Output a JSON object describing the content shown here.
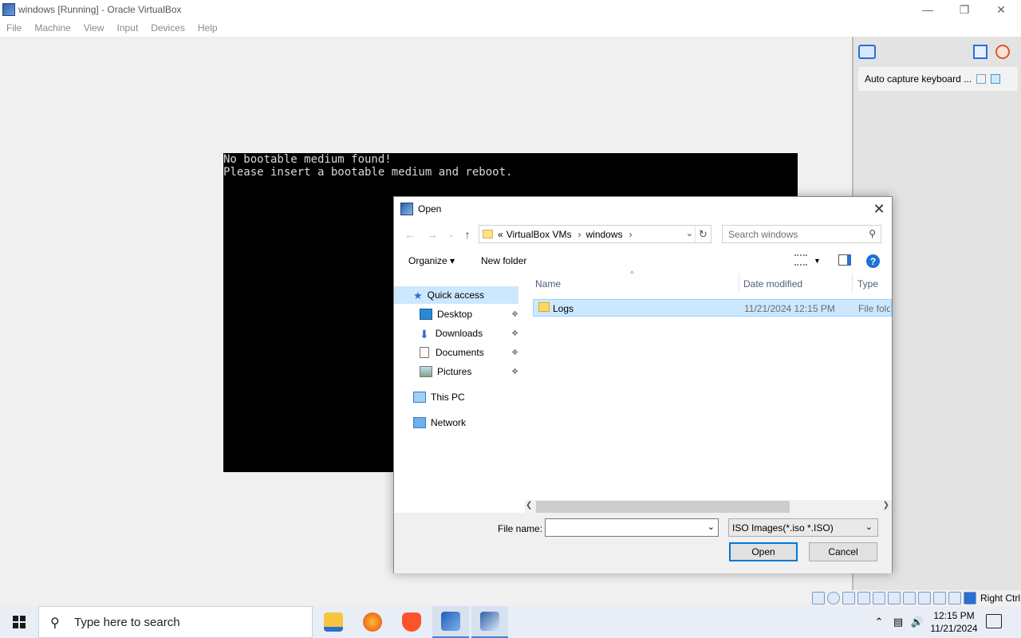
{
  "window": {
    "title": "windows [Running] - Oracle VirtualBox",
    "icon": "virtualbox-icon"
  },
  "menubar": {
    "items": [
      "File",
      "Machine",
      "View",
      "Input",
      "Devices",
      "Help"
    ]
  },
  "vm_screen": {
    "lines": [
      "No bootable medium found!",
      "Please insert a bootable medium and reboot."
    ]
  },
  "notification_pane": {
    "card_text": "Auto capture keyboard ..."
  },
  "statusbar": {
    "host_key": "Right Ctrl"
  },
  "dialog": {
    "title": "Open",
    "address": {
      "prefix": "«",
      "crumbs": [
        "VirtualBox VMs",
        "windows"
      ]
    },
    "search_placeholder": "Search windows",
    "commands": {
      "organize": "Organize ▾",
      "new_folder": "New folder"
    },
    "nav": {
      "quick_access": "Quick access",
      "desktop": "Desktop",
      "downloads": "Downloads",
      "documents": "Documents",
      "pictures": "Pictures",
      "this_pc": "This PC",
      "network": "Network"
    },
    "columns": {
      "name": "Name",
      "date_modified": "Date modified",
      "type": "Type"
    },
    "files": [
      {
        "name": "Logs",
        "date_modified": "11/21/2024 12:15 PM",
        "type": "File fold"
      }
    ],
    "file_name_label": "File name:",
    "file_name_value": "",
    "file_type": "ISO Images(*.iso *.ISO)",
    "open_button": "Open",
    "cancel_button": "Cancel"
  },
  "taskbar": {
    "search_placeholder": "Type here to search",
    "apps": [
      "file-explorer",
      "firefox",
      "brave",
      "virtualbox-manager",
      "virtualbox-vm"
    ],
    "time": "12:15 PM",
    "date": "11/21/2024"
  },
  "colors": {
    "selection": "#cce8ff",
    "accent": "#0078d7",
    "vm_background": "#000000"
  }
}
